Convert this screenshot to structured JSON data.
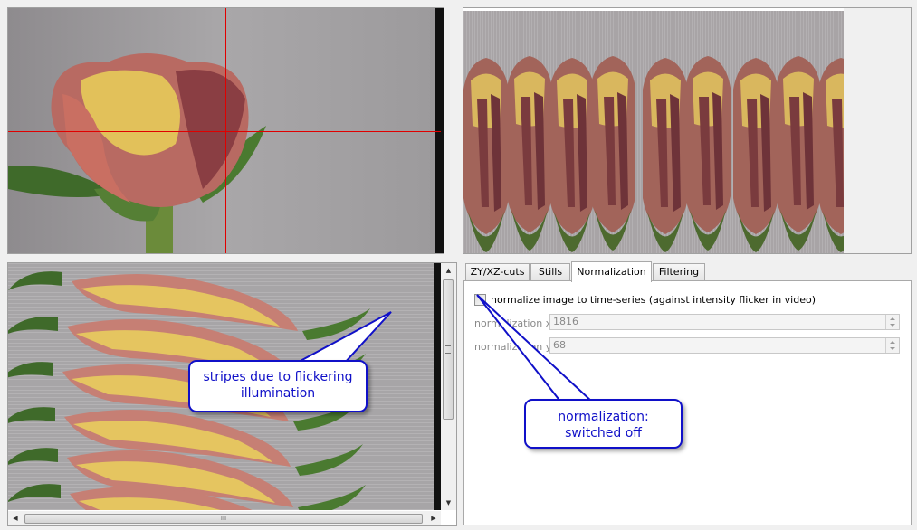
{
  "tabs": [
    {
      "label": "ZY/XZ-cuts",
      "active": false
    },
    {
      "label": "Stills",
      "active": false
    },
    {
      "label": "Normalization",
      "active": true
    },
    {
      "label": "Filtering",
      "active": false
    }
  ],
  "normalization": {
    "checkbox_label": "normalize image to time-series (against intensity flicker in video)",
    "checked": false,
    "x_label": "normalization x:",
    "x_value": "1816",
    "y_label": "normalization y:",
    "y_value": "68"
  },
  "callouts": {
    "stripes": "stripes due to flickering illumination",
    "switch_line1": "normalization:",
    "switch_line2": "switched off"
  },
  "scrollbar": {
    "up": "▲",
    "down": "▼",
    "left": "◀",
    "right": "▶",
    "grip": "III"
  },
  "colors": {
    "crosshair": "#e00000",
    "callout": "#1010c8"
  },
  "images": {
    "main_view": "rose-photo",
    "zy_cut": "rose-cut-strip",
    "xz_cut": "rose-spiral-cut"
  }
}
